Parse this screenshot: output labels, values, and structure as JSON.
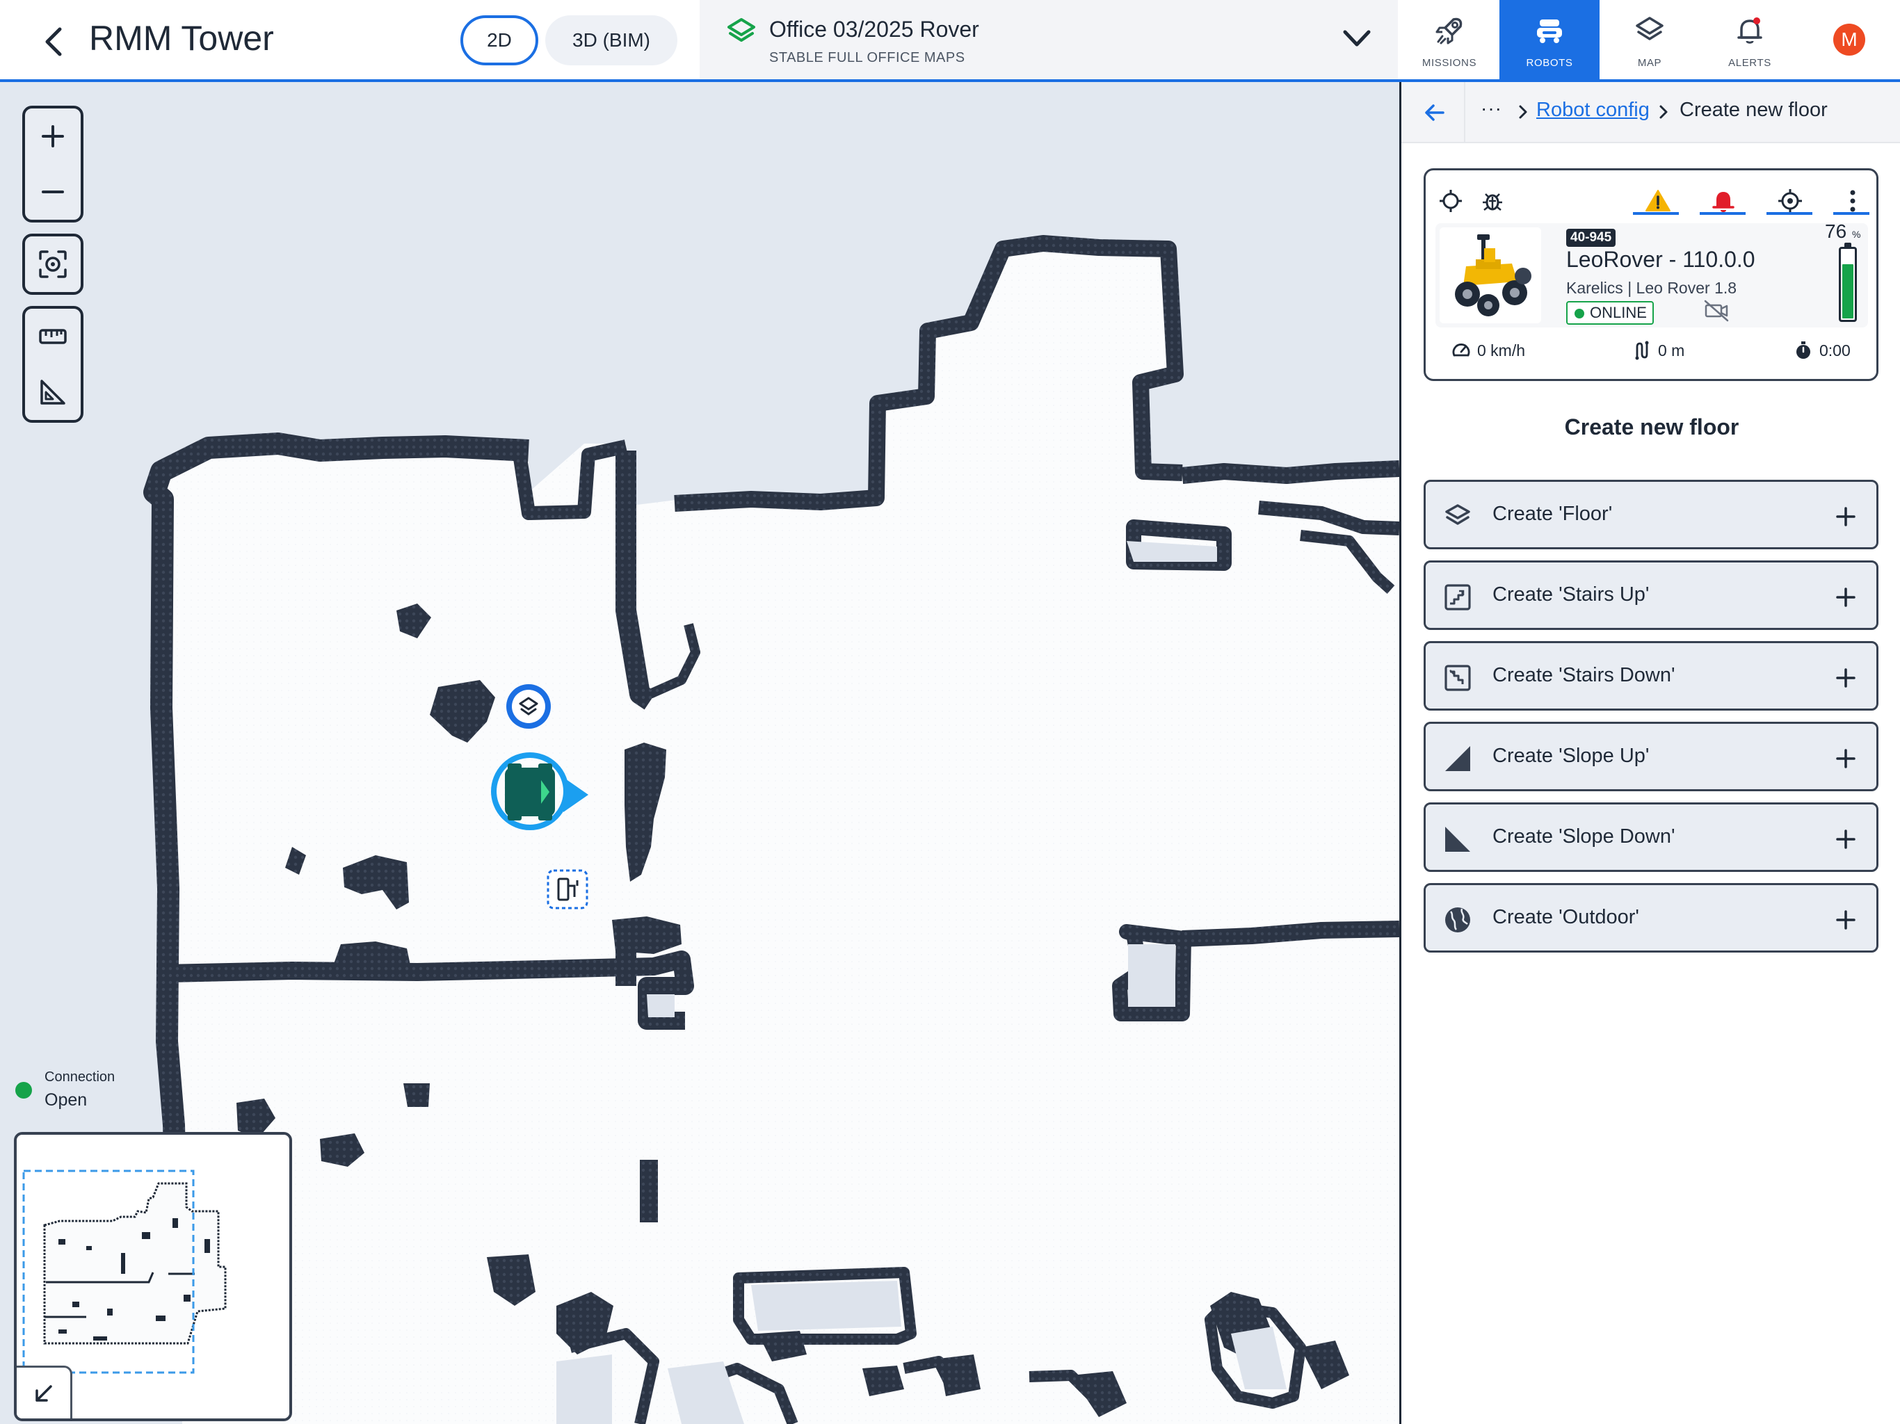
{
  "header": {
    "title": "RMM Tower",
    "view_modes": [
      "2D",
      "3D (BIM)"
    ],
    "active_view": "2D",
    "map_selector": {
      "name": "Office 03/2025 Rover",
      "subtitle": "STABLE FULL OFFICE MAPS"
    },
    "nav": [
      {
        "label": "MISSIONS",
        "icon": "rocket-icon"
      },
      {
        "label": "ROBOTS",
        "icon": "robot-icon",
        "active": true
      },
      {
        "label": "MAP",
        "icon": "layers-icon"
      },
      {
        "label": "ALERTS",
        "icon": "bell-icon"
      }
    ],
    "avatar_initial": "M"
  },
  "map": {
    "connection_label": "Connection",
    "connection_value": "Open",
    "connection_color": "#16a34a"
  },
  "panel": {
    "breadcrumb": {
      "more": "···",
      "link": "Robot config",
      "current": "Create new floor"
    },
    "robot": {
      "id": "40-945",
      "name": "LeoRover - 110.0.0",
      "model": "Karelics | Leo Rover 1.8",
      "status": "ONLINE",
      "battery_percent": "76",
      "battery_unit": "%",
      "battery_level": 0.76,
      "speed": "0 km/h",
      "distance": "0 m",
      "time": "0:00"
    },
    "section_title": "Create new floor",
    "create_items": [
      {
        "label": "Create 'Floor'",
        "icon": "layers-icon"
      },
      {
        "label": "Create 'Stairs Up'",
        "icon": "stairs-up-icon"
      },
      {
        "label": "Create 'Stairs Down'",
        "icon": "stairs-down-icon"
      },
      {
        "label": "Create 'Slope Up'",
        "icon": "slope-up-icon"
      },
      {
        "label": "Create 'Slope Down'",
        "icon": "slope-down-icon"
      },
      {
        "label": "Create 'Outdoor'",
        "icon": "globe-icon"
      }
    ]
  },
  "colors": {
    "accent": "#1b6fe3",
    "wall": "#2d3748",
    "online": "#16a34a",
    "warning": "#f5b301",
    "alert": "#e11d2a"
  }
}
